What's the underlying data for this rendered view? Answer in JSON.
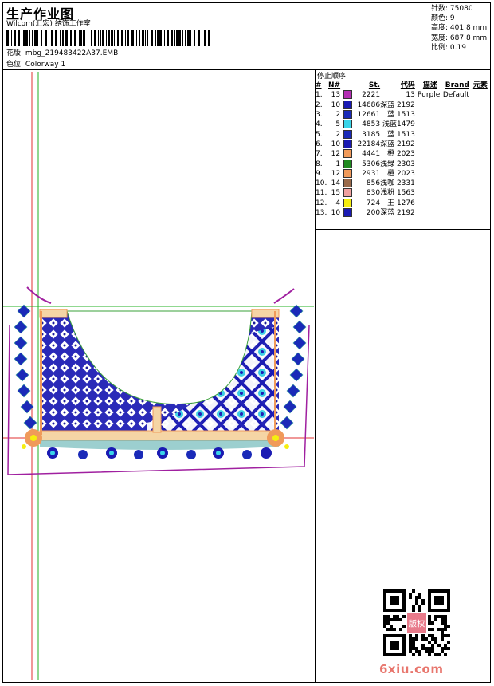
{
  "header": {
    "title": "生产作业图",
    "company": "Wilcom(汇宏) 绣饰工作室",
    "design_label": "花版:",
    "design_file": "mbg_219483422A37.EMB",
    "colorway_label": "色位:",
    "colorway": "Colorway 1"
  },
  "stats": {
    "stitches_label": "针数:",
    "stitches": "75080",
    "colors_label": "颜色:",
    "colors": "9",
    "height_label": "高度:",
    "height": "401.8 mm",
    "width_label": "宽度:",
    "width": "687.8 mm",
    "scale_label": "比例:",
    "scale": "0.19"
  },
  "sequence": {
    "title": "停止顺序:",
    "headers": {
      "index": "#",
      "needle": "N#",
      "stitches": "St.",
      "code": "代码",
      "desc": "描述",
      "brand": "Brand",
      "element": "元素"
    },
    "rows": [
      {
        "index": "1.",
        "needle": "13",
        "color": "#b32eb3",
        "stitches": "2221",
        "code": "13",
        "desc": "Purple",
        "brand": "Default"
      },
      {
        "index": "2.",
        "needle": "10",
        "color": "#1a1ab3",
        "stitches": "14686",
        "code": "深蓝 2192",
        "desc": "",
        "brand": ""
      },
      {
        "index": "3.",
        "needle": "2",
        "color": "#1a2ab8",
        "stitches": "12661",
        "code": "蓝 1513",
        "desc": "",
        "brand": ""
      },
      {
        "index": "4.",
        "needle": "5",
        "color": "#3ad4e8",
        "stitches": "4853",
        "code": "浅蓝1479",
        "desc": "",
        "brand": ""
      },
      {
        "index": "5.",
        "needle": "2",
        "color": "#1a2ab8",
        "stitches": "3185",
        "code": "蓝 1513",
        "desc": "",
        "brand": ""
      },
      {
        "index": "6.",
        "needle": "10",
        "color": "#1a1ab3",
        "stitches": "22184",
        "code": "深蓝 2192",
        "desc": "",
        "brand": ""
      },
      {
        "index": "7.",
        "needle": "12",
        "color": "#f09a5a",
        "stitches": "4441",
        "code": "橙 2023",
        "desc": "",
        "brand": ""
      },
      {
        "index": "8.",
        "needle": "1",
        "color": "#1f8a1f",
        "stitches": "5306",
        "code": "浅绿 2303",
        "desc": "",
        "brand": ""
      },
      {
        "index": "9.",
        "needle": "12",
        "color": "#f09a5a",
        "stitches": "2931",
        "code": "橙 2023",
        "desc": "",
        "brand": ""
      },
      {
        "index": "10.",
        "needle": "14",
        "color": "#9a6a4a",
        "stitches": "856",
        "code": "浅咖 2331",
        "desc": "",
        "brand": ""
      },
      {
        "index": "11.",
        "needle": "15",
        "color": "#f0a0a0",
        "stitches": "830",
        "code": "浅粉 1563",
        "desc": "",
        "brand": ""
      },
      {
        "index": "12.",
        "needle": "4",
        "color": "#f5ee10",
        "stitches": "724",
        "code": "王 1276",
        "desc": "",
        "brand": ""
      },
      {
        "index": "13.",
        "needle": "10",
        "color": "#1a1ab3",
        "stitches": "200",
        "code": "深蓝 2192",
        "desc": "",
        "brand": ""
      }
    ]
  },
  "watermark": {
    "text": "6xiu.com",
    "stamp": "版权"
  }
}
